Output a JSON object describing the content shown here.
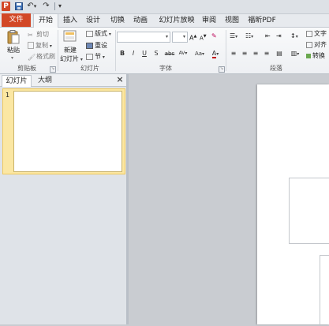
{
  "app": {
    "logo_letter": "P"
  },
  "qat": {
    "save_icon": "save-icon",
    "undo_glyph": "↶",
    "undo_dd": "▾",
    "redo_glyph": "↷",
    "customize_glyph": "▾"
  },
  "tabs": [
    "文件",
    "开始",
    "插入",
    "设计",
    "切换",
    "动画",
    "幻灯片放映",
    "审阅",
    "视图",
    "福昕PDF"
  ],
  "ribbon": {
    "clipboard": {
      "paste": "粘贴",
      "cut": "剪切",
      "copy": "复制",
      "format_painter": "格式刷",
      "label": "剪贴板"
    },
    "slides": {
      "new_slide_line1": "新建",
      "new_slide_line2": "幻灯片",
      "layout": "版式",
      "reset": "重设",
      "section": "节",
      "label": "幻灯片"
    },
    "font": {
      "font_value": "",
      "size_value": "",
      "grow": "A",
      "shrink": "A",
      "bold": "B",
      "italic": "I",
      "underline": "U",
      "shadow": "S",
      "strike": "abc",
      "spacing": "AV",
      "case": "Aa",
      "color": "A",
      "label": "字体"
    },
    "paragraph": {
      "text_direction": "文字",
      "align_text": "对齐",
      "smartart": "转换",
      "label": "段落"
    }
  },
  "pane": {
    "tab_slides": "幻灯片",
    "tab_outline": "大纲",
    "close": "×",
    "slide_number": "1"
  },
  "colors": {
    "accent": "#d24726",
    "selection": "#fbe7a3"
  }
}
